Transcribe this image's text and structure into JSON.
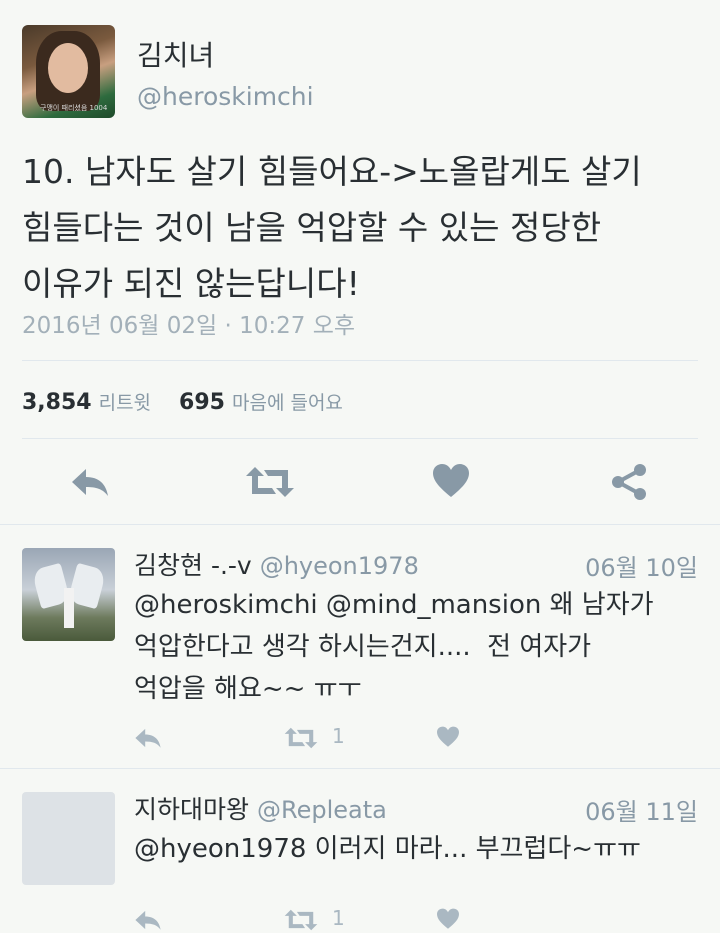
{
  "tweet": {
    "author_name": "김치녀",
    "author_handle": "@heroskimchi",
    "avatar_caption": "구맹이 때리셨음 1004",
    "text": "10. 남자도 살기 힘들어요->노올랍게도 살기\n힘들다는 것이 남을 억압할 수 있는 정당한\n이유가 되진 않는답니다!",
    "timestamp": "2016년 06월 02일 · 10:27 오후",
    "retweets": "3,854",
    "retweets_label": "리트윗",
    "likes": "695",
    "likes_label": "마음에 들어요"
  },
  "replies": [
    {
      "name": "김창현 -.-v",
      "handle": "@hyeon1978",
      "date": "06월 10일",
      "text": "@heroskimchi @mind_mansion 왜 남자가\n억압한다고 생각 하시는건지....  전 여자가\n억압을 해요~~ ㅠㅜ",
      "retweet_count": "1"
    },
    {
      "name": "지하대마왕",
      "handle": "@Repleata",
      "date": "06월 11일",
      "text": "@hyeon1978 이러지 마라... 부끄럽다~ㅠㅠ",
      "retweet_count": "1"
    }
  ],
  "colors": {
    "background": "#f6f8f5",
    "text": "#292f33",
    "secondary": "#8899a6",
    "icon_main": "#8899a6",
    "icon_reply": "#aab8c2",
    "divider": "#e1e8ed"
  }
}
